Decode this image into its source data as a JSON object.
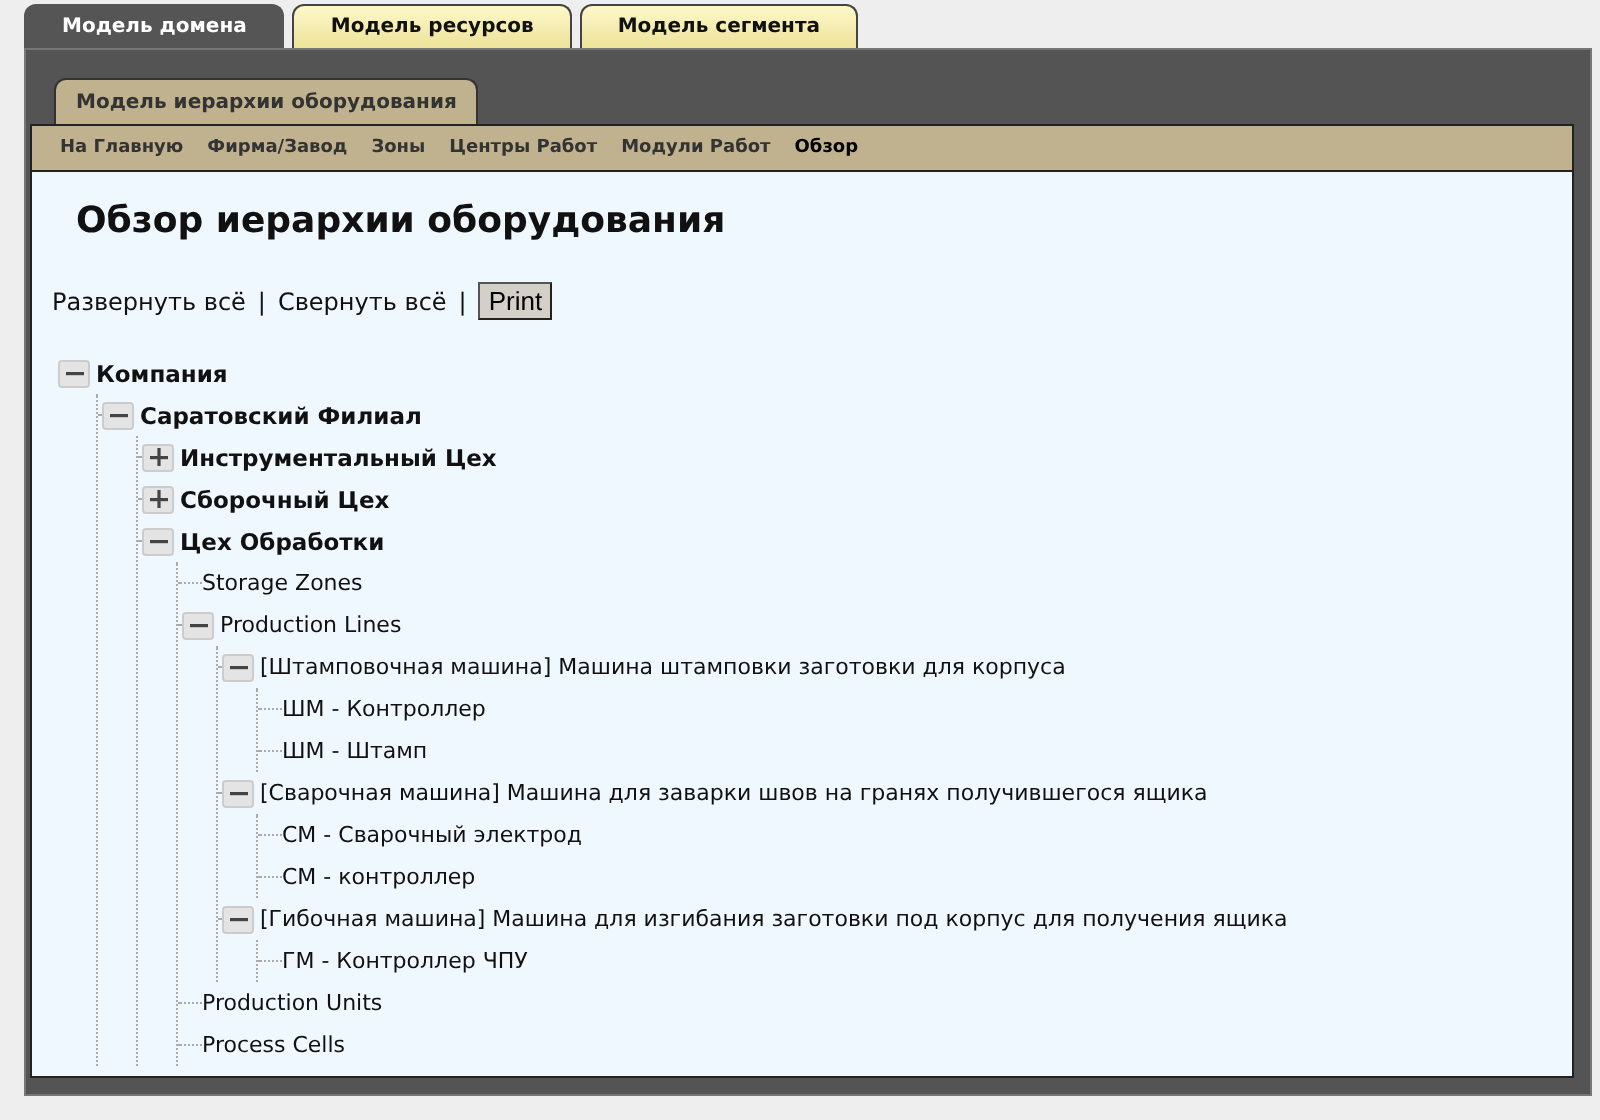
{
  "top_tabs": [
    {
      "label": "Модель домена",
      "selected": true
    },
    {
      "label": "Модель ресурсов",
      "selected": false
    },
    {
      "label": "Модель сегмента",
      "selected": false
    }
  ],
  "sub_tabs": [
    {
      "label": "Модель иерархии оборудования",
      "selected": true
    }
  ],
  "nav": [
    {
      "label": "На Главную",
      "selected": false
    },
    {
      "label": "Фирма/Завод",
      "selected": false
    },
    {
      "label": "Зоны",
      "selected": false
    },
    {
      "label": "Центры Работ",
      "selected": false
    },
    {
      "label": "Модули Работ",
      "selected": false
    },
    {
      "label": "Обзор",
      "selected": true
    }
  ],
  "page_title": "Обзор иерархии оборудования",
  "actions": {
    "expand_all": "Развернуть всё",
    "separator_1": "|",
    "collapse_all": "Свернуть всё",
    "separator_2": "|",
    "print": "Print"
  },
  "tree": [
    {
      "label": "Компания",
      "kind": "group",
      "expanded": true,
      "children": [
        {
          "label": "Саратовский Филиал",
          "kind": "group",
          "expanded": true,
          "children": [
            {
              "label": "Инструментальный Цех",
              "kind": "group",
              "expanded": false
            },
            {
              "label": "Сборочный Цех",
              "kind": "group",
              "expanded": false
            },
            {
              "label": "Цех Обработки",
              "kind": "group",
              "expanded": true,
              "children": [
                {
                  "label": "Storage Zones",
                  "kind": "leaf"
                },
                {
                  "label": "Production Lines",
                  "kind": "item",
                  "expanded": true,
                  "children": [
                    {
                      "label": "[Штамповочная машина] Машина штамповки заготовки для корпуса",
                      "kind": "item",
                      "expanded": true,
                      "children": [
                        {
                          "label": "ШМ - Контроллер",
                          "kind": "leaf"
                        },
                        {
                          "label": "ШМ - Штамп",
                          "kind": "leaf"
                        }
                      ]
                    },
                    {
                      "label": "[Сварочная машина] Машина для заварки швов на гранях получившегося ящика",
                      "kind": "item",
                      "expanded": true,
                      "children": [
                        {
                          "label": "СМ - Сварочный электрод",
                          "kind": "leaf"
                        },
                        {
                          "label": "СМ - контроллер",
                          "kind": "leaf"
                        }
                      ]
                    },
                    {
                      "label": "[Гибочная машина] Машина для изгибания заготовки под корпус для получения ящика",
                      "kind": "item",
                      "expanded": true,
                      "children": [
                        {
                          "label": "ГМ - Контроллер ЧПУ",
                          "kind": "leaf"
                        }
                      ]
                    }
                  ]
                },
                {
                  "label": "Production Units",
                  "kind": "leaf"
                },
                {
                  "label": "Process Cells",
                  "kind": "leaf"
                }
              ]
            }
          ]
        }
      ]
    }
  ]
}
